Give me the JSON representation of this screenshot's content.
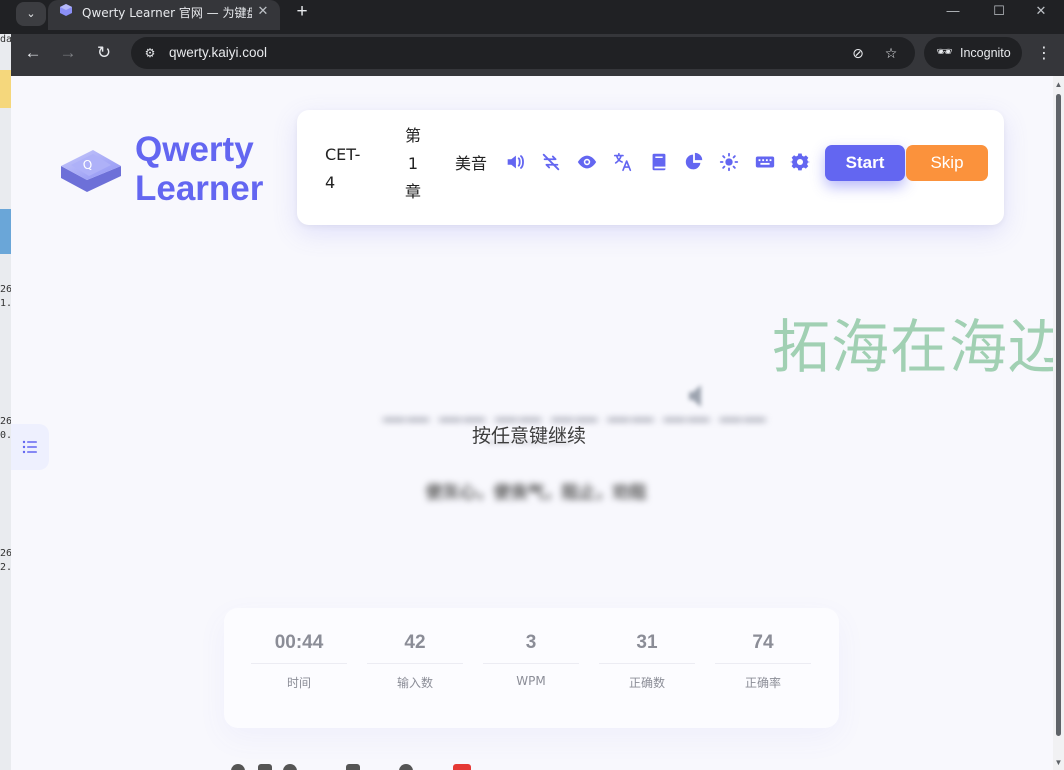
{
  "browser": {
    "tab": {
      "title": "Qwerty Learner 官网 — 为键盘工作者设计的单词与肌肉记忆锻炼软件",
      "close_glyph": "✕"
    },
    "tab_menu_glyph": "⌄",
    "new_tab_glyph": "+",
    "window_controls": {
      "minimize": "—",
      "maximize": "☐",
      "close": "✕"
    },
    "nav": {
      "back": "←",
      "forward": "→",
      "reload": "↻"
    },
    "address": {
      "url": "qwerty.kaiyi.cool",
      "site_info_glyph": "⚙"
    },
    "omnibox_icons": {
      "eye_off": "⊘",
      "star": "☆"
    },
    "incognito": {
      "label": "Incognito",
      "glyph": "🕶"
    },
    "menu_glyph": "⋮"
  },
  "desktop_strip": {
    "fragments": [
      "da",
      "26",
      "1.",
      "26",
      "0.",
      "26",
      "2."
    ]
  },
  "app": {
    "logo": {
      "name_line1": "Qwerty",
      "name_line2": "Learner",
      "brand_color": "#6366f1"
    },
    "header": {
      "dictionary_line1": "CET-",
      "dictionary_line2": "4",
      "chapter_line1": "第",
      "chapter_line2": "1",
      "chapter_line3": "章",
      "pronunciation": "美音",
      "tools": [
        "speaker-icon",
        "loop-off-icon",
        "eye-icon",
        "translate-icon",
        "book-icon",
        "pie-chart-icon",
        "sun-icon",
        "keyboard-icon",
        "gear-icon"
      ],
      "start_label": "Start",
      "skip_label": "Skip",
      "start_color": "#6366f1",
      "skip_color": "#fb923c"
    },
    "watermark": "拓海在海边",
    "word": {
      "masked_word": "—— —— —— —— —— —— ——",
      "phonetic": "—— —— ——",
      "translation": "使灰心，使丧气，阻止，劝阻",
      "hint": "按任意键继续"
    },
    "stats": [
      {
        "value": "00:44",
        "label": "时间"
      },
      {
        "value": "42",
        "label": "输入数"
      },
      {
        "value": "3",
        "label": "WPM"
      },
      {
        "value": "31",
        "label": "正确数"
      },
      {
        "value": "74",
        "label": "正确率"
      }
    ]
  }
}
